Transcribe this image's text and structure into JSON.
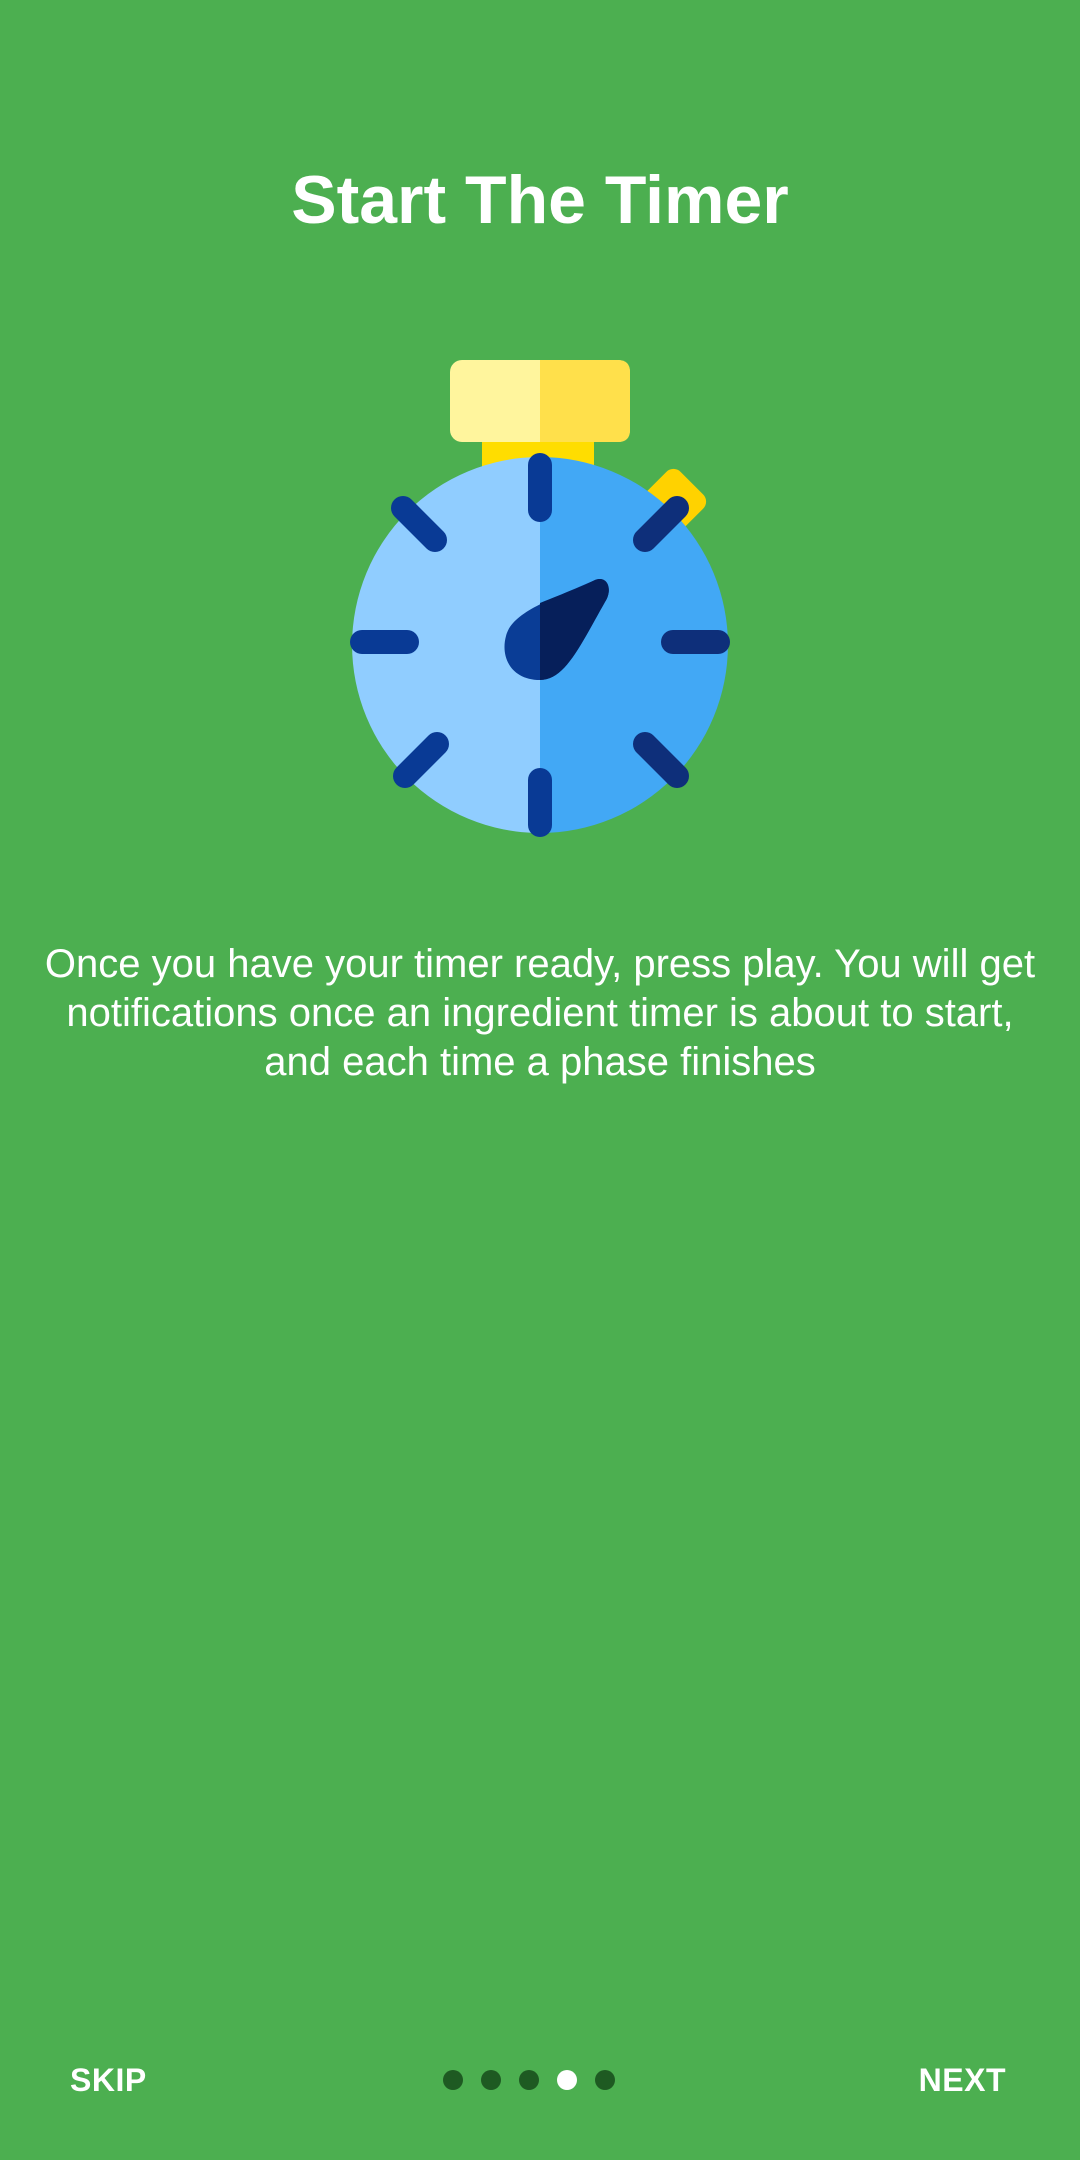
{
  "onboarding": {
    "title": "Start The Timer",
    "description": "Once you have your timer ready, press play. You will get notifications once an ingredient timer is about to start, and each time a phase finishes",
    "illustration": "stopwatch-icon"
  },
  "navigation": {
    "skip_label": "SKIP",
    "next_label": "NEXT",
    "page_count": 5,
    "current_page": 4
  },
  "colors": {
    "background": "#4caf50",
    "text": "#ffffff",
    "dot_inactive": "#1e5a22",
    "dot_active": "#ffffff"
  }
}
